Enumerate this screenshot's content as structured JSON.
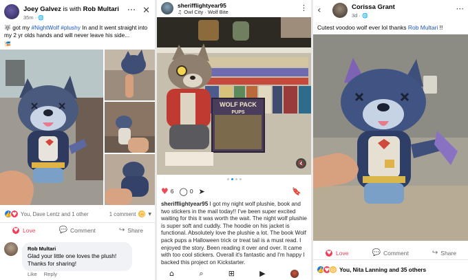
{
  "fb_post": {
    "author": "Joey Galvez",
    "with_text": "is with",
    "tagged": "Rob Multari",
    "time": "35m",
    "caption_pre": "got my ",
    "hashtag1": "#NightWolf",
    "hashtag2": "#plushy",
    "caption_post": " In and It went straight into my 2 yr olds hands and will never leave his side...",
    "reactions_text": "You, Dave Lentz and 1 other",
    "comment_count": "1 comment",
    "like_label": "Love",
    "comment_label": "Comment",
    "share_label": "Share",
    "reply": {
      "author": "Rob Multari",
      "text": "Glad your little one loves the plush! Thanks for sharing!",
      "like_label": "Like",
      "reply_label": "Reply"
    }
  },
  "ig_post": {
    "username": "sheriffIightyear95",
    "music": "Owl City · Wolf Bite",
    "likes": "6",
    "comments": "0",
    "caption_user": "sheriffIightyear95",
    "caption_text": " I got my night wolf plushie, book and two stickers in the mail today!! I've been super excited waiting for this it was worth the wait. The night wolf plushie is super soft and cuddly. The hoodie on his jacket is functional. Absolutely love the plushie a lot. The book Wolf pack pups a Halloween trick or treat tail is a must read. I enjoyed the story. Been reading it over and over. It came with too cool stickers. Overall it's fantastic and I'm happy I backed this project on Kickstarter.",
    "book_title_line1": "WOLF PACK",
    "book_title_line2": "PUPS"
  },
  "fb_post2": {
    "author": "Corissa Grant",
    "time": "3d",
    "caption_pre": "Cutest voodoo wolf ever lol thanks ",
    "caption_link": "Rob Multari",
    "caption_post": " !!",
    "like_label": "Love",
    "comment_label": "Comment",
    "share_label": "Share",
    "reactions_text": "You, Nita Lanning and 35 others"
  },
  "colors": {
    "fb_blue": "#1877f2",
    "love_red": "#f33e58",
    "ig_red": "#ed4956",
    "ig_blue": "#0095f6"
  },
  "icons": [
    "close-icon",
    "more-icon",
    "back-icon",
    "heart-icon",
    "comment-icon",
    "share-icon",
    "bookmark-icon",
    "home-icon",
    "search-icon",
    "add-icon",
    "reels-icon",
    "mute-icon"
  ]
}
